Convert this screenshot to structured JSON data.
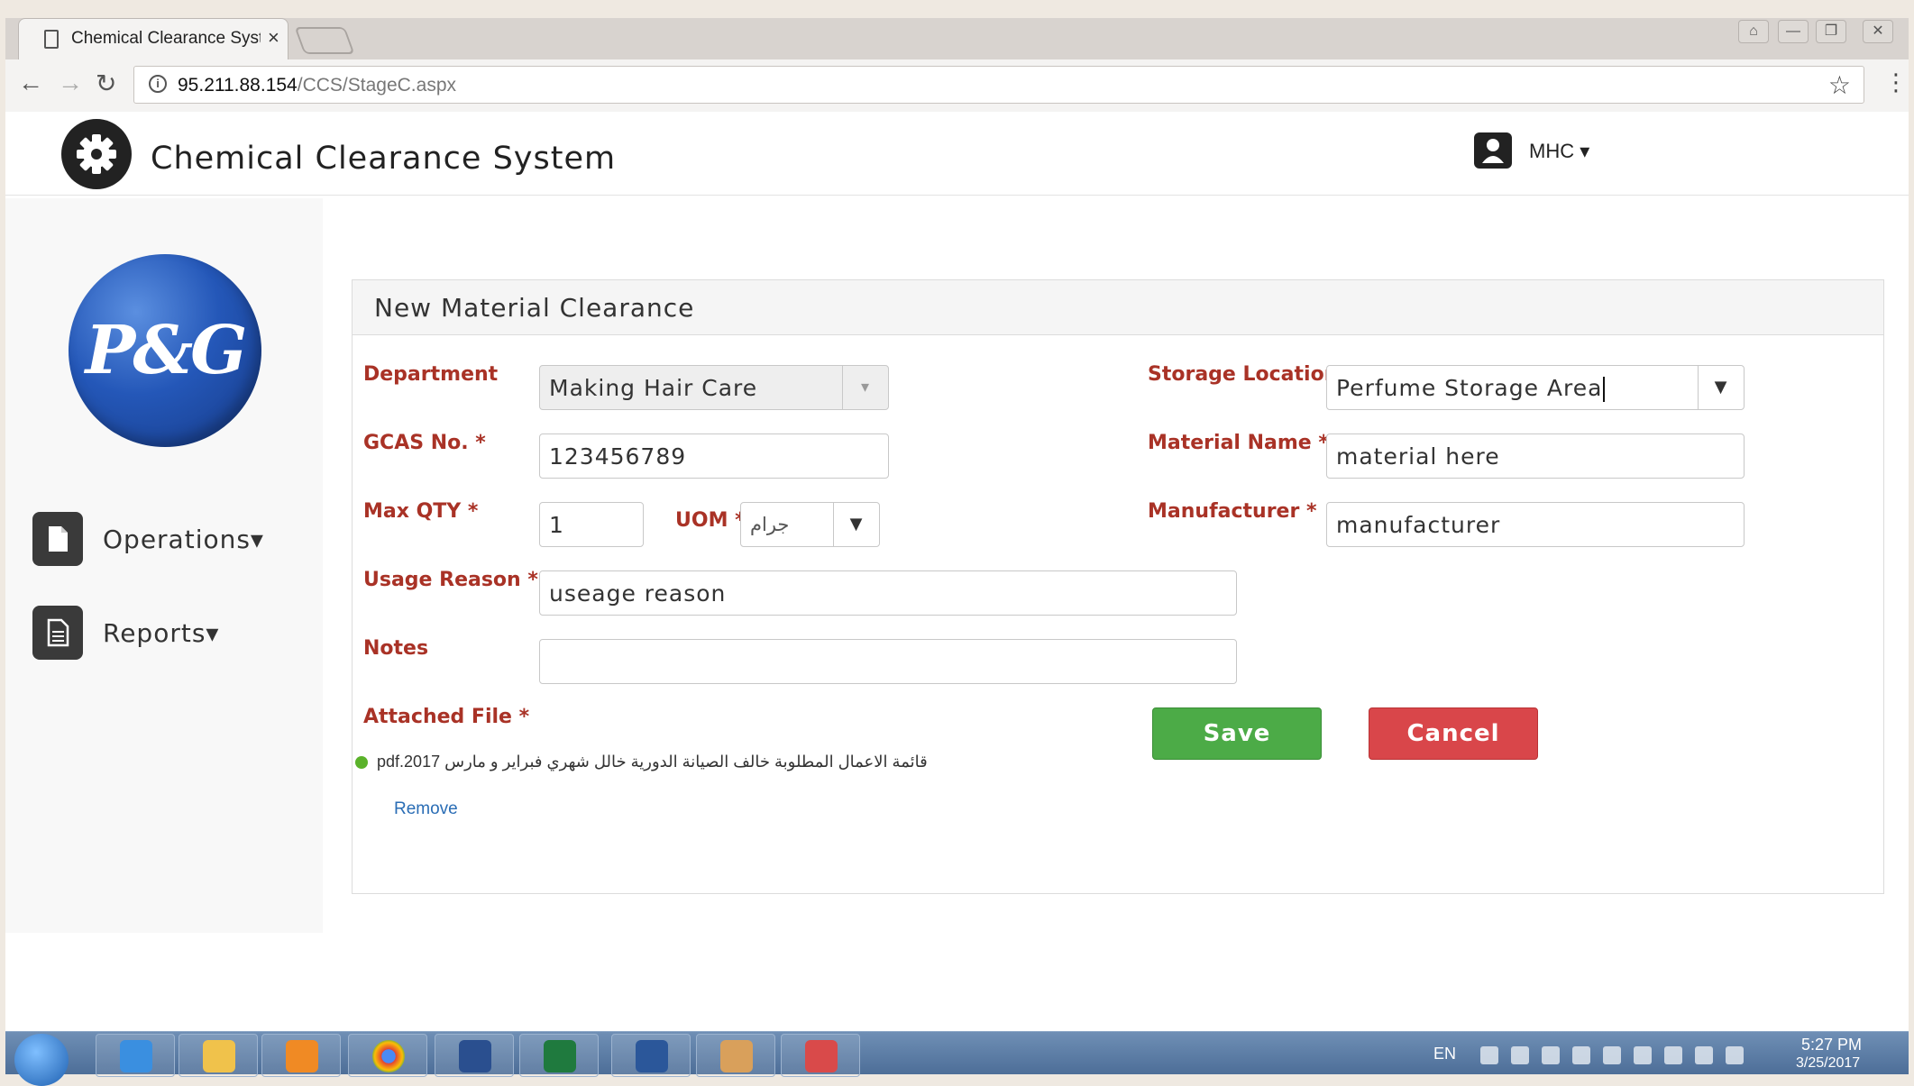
{
  "browser": {
    "tab_title": "Chemical Clearance System",
    "tab_close": "×",
    "url_host": "95.211.88.154",
    "url_path": "/CCS/StageC.aspx",
    "back": "←",
    "forward": "→",
    "reload": "↻",
    "star": "☆",
    "menu": "⋮",
    "info": "i",
    "window_controls": [
      "⌂",
      "—",
      "❐",
      "✕"
    ]
  },
  "header": {
    "title": "Chemical Clearance System",
    "user": "MHC ▾"
  },
  "sidebar": {
    "logo_text": "P&G",
    "items": [
      {
        "label": "Operations▾",
        "icon": "file-icon"
      },
      {
        "label": "Reports▾",
        "icon": "document-icon"
      }
    ]
  },
  "form": {
    "title": "New Material Clearance",
    "department": {
      "label": "Department",
      "value": "Making Hair Care"
    },
    "gcas": {
      "label": "GCAS No. *",
      "value": "123456789"
    },
    "max_qty": {
      "label": "Max QTY *",
      "value": "1"
    },
    "uom": {
      "label": "UOM *",
      "value": "جرام"
    },
    "usage_reason": {
      "label": "Usage Reason *",
      "value": "useage reason"
    },
    "notes": {
      "label": "Notes",
      "value": ""
    },
    "attached_file": {
      "label": "Attached File *",
      "file_name": "قائمة الاعمال المطلوبة خالف الصيانة الدورية خالل شهري فبراير و مارس 2017.pdf",
      "remove": "Remove"
    },
    "storage_location": {
      "label": "Storage Location",
      "value": "Perfume Storage Area"
    },
    "material_name": {
      "label": "Material Name *",
      "value": "material here"
    },
    "manufacturer": {
      "label": "Manufacturer *",
      "value": "manufacturer"
    },
    "save": "Save",
    "cancel": "Cancel"
  },
  "taskbar": {
    "lang": "EN",
    "time": "5:27 PM",
    "date": "3/25/2017",
    "apps": [
      "internet-explorer-icon",
      "file-explorer-icon",
      "media-player-icon",
      "chrome-icon",
      "remote-desktop-icon",
      "excel-icon",
      "word-icon",
      "paint-icon",
      "snipping-tool-icon"
    ]
  },
  "colors": {
    "label_red": "#a93226",
    "save_green": "#4cab47",
    "cancel_red": "#d9464a",
    "pg_blue": "#2457b8"
  }
}
